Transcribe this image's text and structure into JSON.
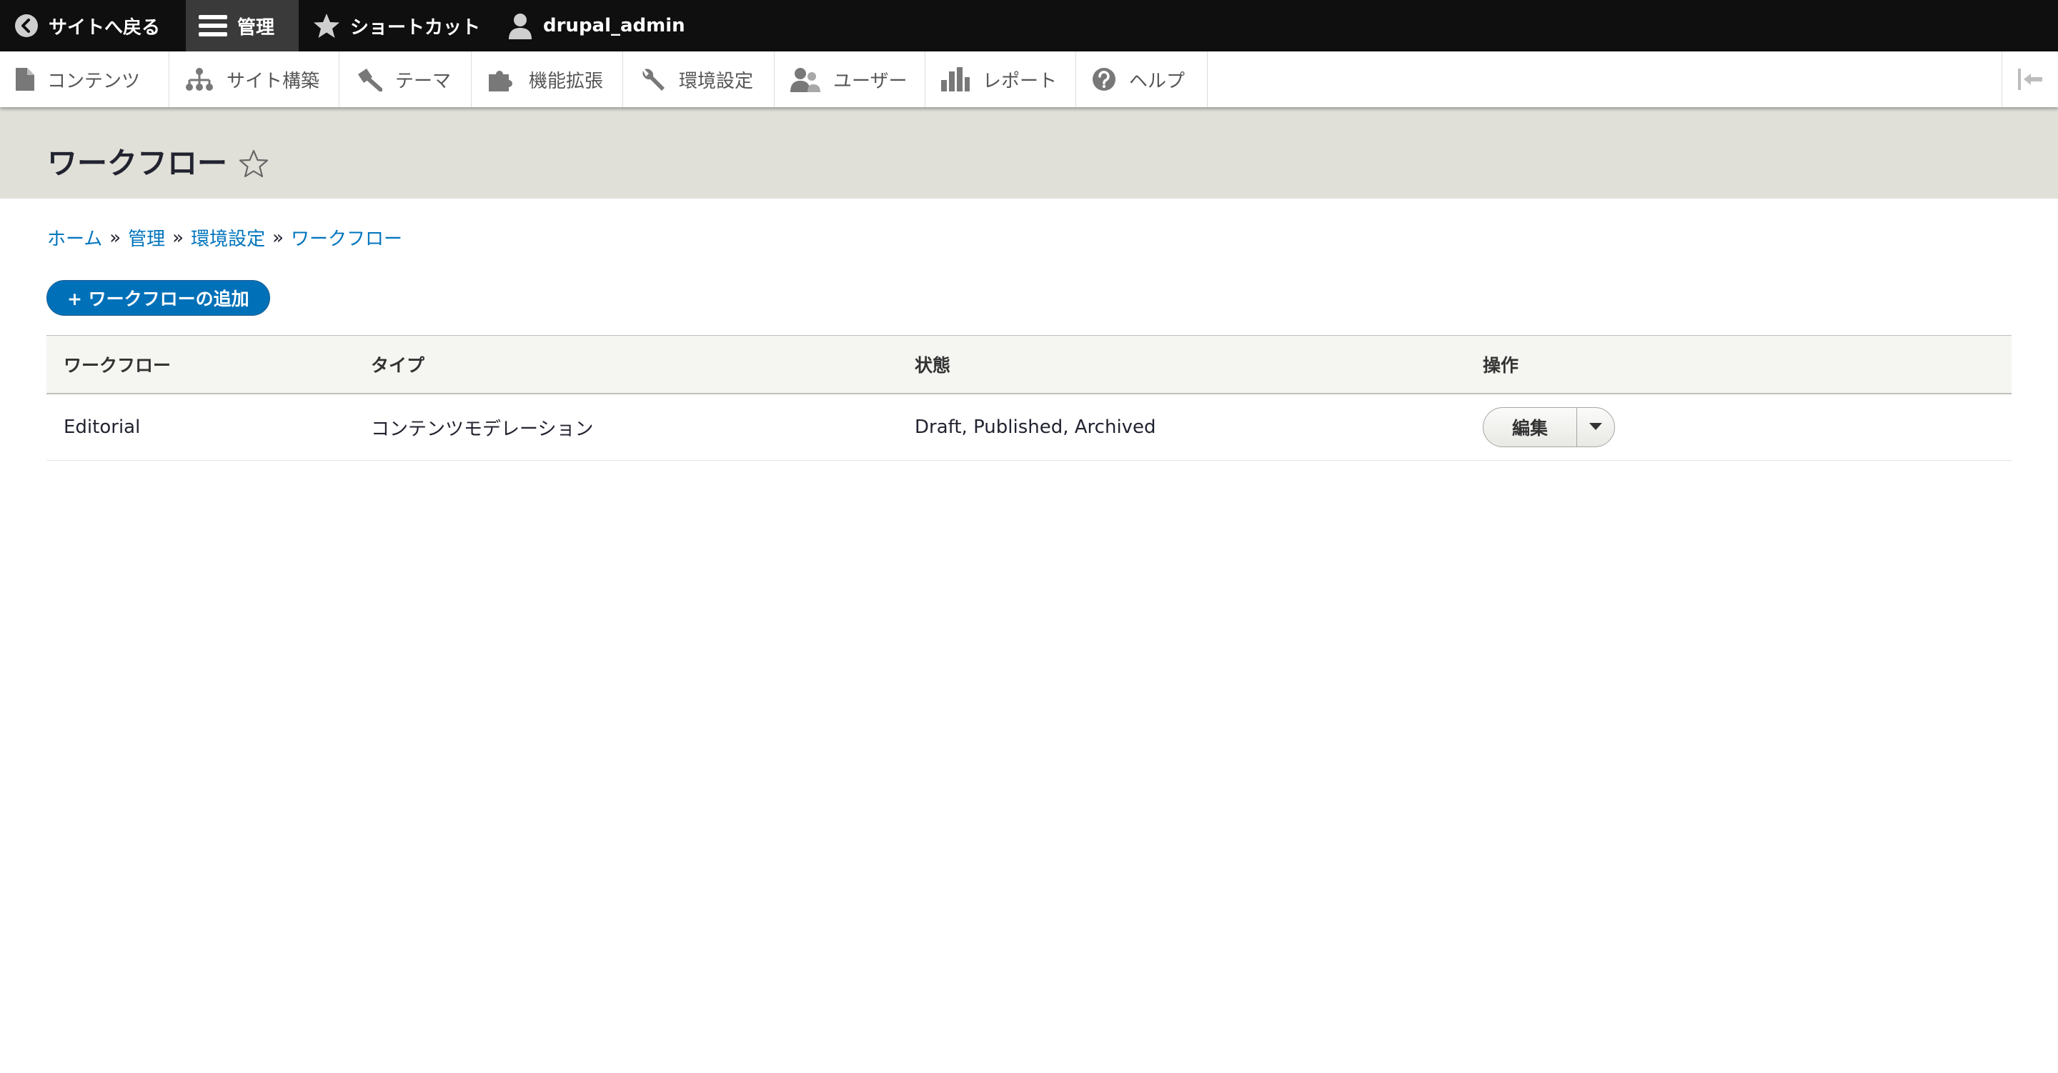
{
  "toolbar": {
    "back_to_site": "サイトへ戻る",
    "manage": "管理",
    "shortcuts": "ショートカット",
    "user": "drupal_admin"
  },
  "tray": {
    "items": [
      {
        "label": "コンテンツ",
        "icon": "file-icon"
      },
      {
        "label": "サイト構築",
        "icon": "sitemap-icon"
      },
      {
        "label": "テーマ",
        "icon": "paintbrush-icon"
      },
      {
        "label": "機能拡張",
        "icon": "puzzle-icon"
      },
      {
        "label": "環境設定",
        "icon": "wrench-icon"
      },
      {
        "label": "ユーザー",
        "icon": "people-icon"
      },
      {
        "label": "レポート",
        "icon": "bar-chart-icon"
      },
      {
        "label": "ヘルプ",
        "icon": "help-icon"
      }
    ]
  },
  "page": {
    "title": "ワークフロー"
  },
  "breadcrumb": {
    "items": [
      "ホーム",
      "管理",
      "環境設定",
      "ワークフロー"
    ],
    "separator": "»"
  },
  "actions": {
    "add_workflow": "+ ワークフローの追加"
  },
  "table": {
    "headers": [
      "ワークフロー",
      "タイプ",
      "状態",
      "操作"
    ],
    "rows": [
      {
        "workflow": "Editorial",
        "type": "コンテンツモデレーション",
        "states": "Draft, Published, Archived",
        "operation": "編集"
      }
    ]
  },
  "colors": {
    "toolbar_bg": "#0f0f0f",
    "header_bg": "#e0e0d8",
    "link": "#0074bd",
    "primary_button": "#0071b8"
  }
}
